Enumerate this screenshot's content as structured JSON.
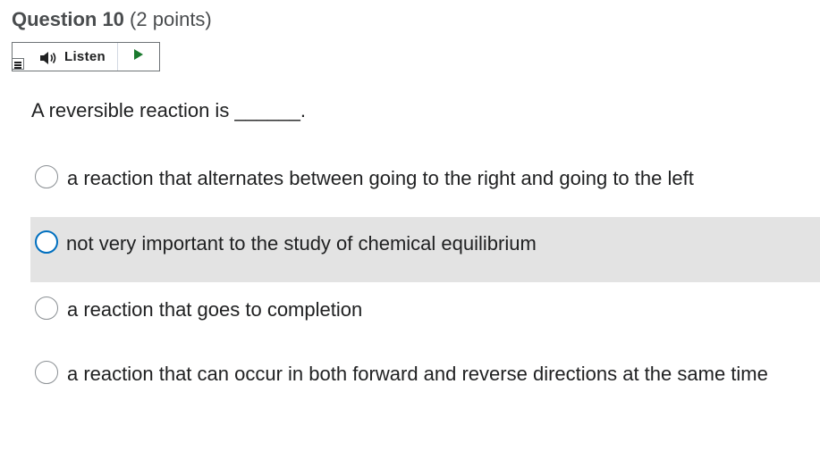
{
  "question": {
    "number_label": "Question 10",
    "points_label": "(2 points)",
    "text": "A reversible reaction is ______."
  },
  "listen": {
    "label": "Listen",
    "menu_icon": "menu-icon",
    "speaker_icon": "speaker-icon",
    "play_icon": "play-icon"
  },
  "options": [
    {
      "label": "a reaction that alternates between going to the right and going to the left",
      "selected": false
    },
    {
      "label": "not very important to the study of chemical equilibrium",
      "selected": false
    },
    {
      "label": "a reaction that goes to completion",
      "selected": false
    },
    {
      "label": "a reaction that can occur in both forward and reverse directions at the same time",
      "selected": false
    }
  ],
  "colors": {
    "highlight_bg": "#e3e3e3",
    "focus_ring": "#006fbf",
    "play_arrow": "#1a7a2e",
    "header_text": "#494c4e"
  }
}
